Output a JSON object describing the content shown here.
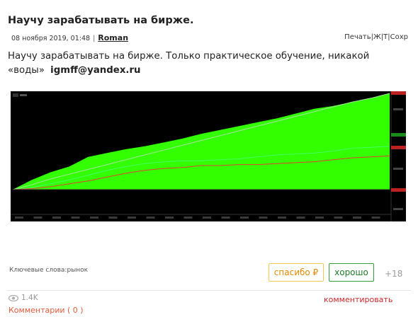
{
  "post": {
    "title": "Научу зарабатывать на бирже.",
    "date": "08 ноября 2019, 01:48",
    "separator": "|",
    "author": "Roman",
    "tools": [
      "Печать",
      "Ж",
      "Т",
      "Сохр"
    ],
    "body": "Научу зарабатывать на бирже. Только практическое обучение, никакой «воды»",
    "email": "igmff@yandex.ru"
  },
  "footer": {
    "keywords_label": "Ключевые слова:",
    "keywords_value": "рынок",
    "thanks_label": "спасибо ₽",
    "good_label": "хорошо",
    "score": "+18",
    "views": "1.4K",
    "comments_label": "Комментарии ( 0 )",
    "comment_action": "комментировать"
  },
  "colors": {
    "chart_bg": "#000000",
    "equity_fill": "#33ff00",
    "thanks_border": "#f2c94c",
    "good_border": "#2e9d3a",
    "comments": "#e05a3a",
    "comment_action": "#c8282a"
  },
  "chart_data": {
    "type": "area",
    "title": "",
    "xlabel": "",
    "ylabel": "",
    "grid": false,
    "x": [
      0,
      5,
      10,
      15,
      20,
      25,
      30,
      35,
      40,
      45,
      50,
      55,
      60,
      65,
      70,
      75,
      80,
      85,
      90,
      95,
      100
    ],
    "series": [
      {
        "values": [
          0,
          10,
          18,
          24,
          34,
          38,
          42,
          45,
          49,
          53,
          58,
          62,
          66,
          70,
          74,
          79,
          84,
          87,
          91,
          95,
          100
        ]
      },
      {
        "values": [
          0,
          5,
          11,
          16,
          21,
          26,
          31,
          36,
          41,
          46,
          51,
          56,
          61,
          66,
          71,
          76,
          81,
          86,
          91,
          95,
          100
        ]
      },
      {
        "values": [
          0,
          2,
          6,
          10,
          15,
          20,
          24,
          27,
          29,
          30,
          30,
          31,
          32,
          34,
          36,
          37,
          38,
          40,
          43,
          44,
          45
        ]
      },
      {
        "values": [
          0,
          1,
          3,
          6,
          9,
          13,
          17,
          20,
          22,
          23,
          25,
          25,
          26,
          26,
          27,
          28,
          29,
          31,
          33,
          34,
          35
        ]
      }
    ]
  }
}
